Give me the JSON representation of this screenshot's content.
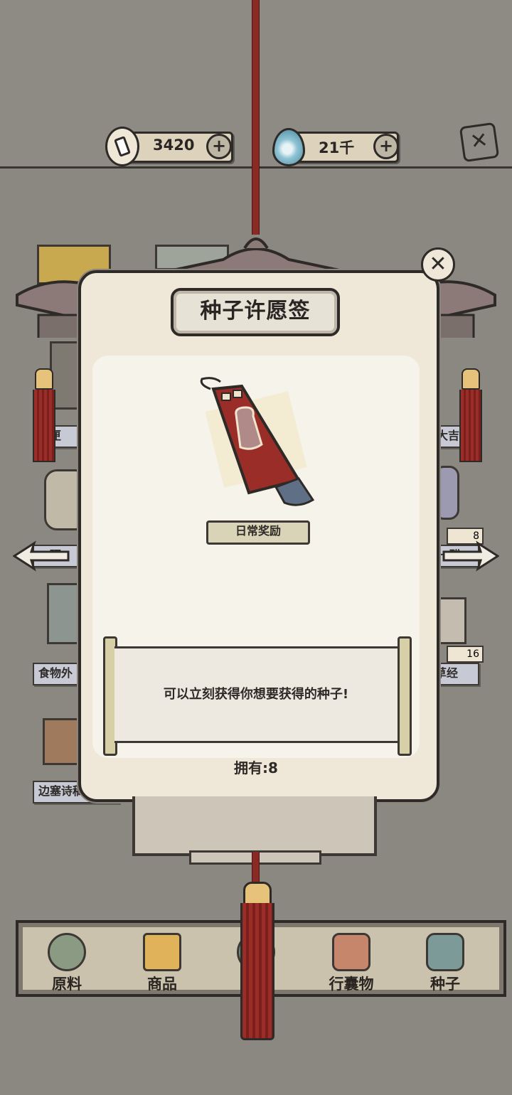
{
  "header": {
    "coins": {
      "value": "3420",
      "add_label": "+"
    },
    "gems": {
      "value": "21千",
      "add_label": "+"
    },
    "close_label": "✕"
  },
  "dialog": {
    "title": "种子许愿签",
    "close_label": "✕",
    "badge": "日常奖励",
    "description": "可以立刻获得你想要获得的种子!",
    "owned": "拥有:8"
  },
  "background": {
    "labels": [
      "一匣",
      "大吉",
      "一研",
      "一醋",
      "食物外",
      "草经",
      "边塞诗稿"
    ],
    "counts": [
      "8",
      "16"
    ]
  },
  "tabs": [
    {
      "label": "原料"
    },
    {
      "label": "商品"
    },
    {
      "label": ""
    },
    {
      "label": "行囊物"
    },
    {
      "label": "种子"
    }
  ],
  "colors": {
    "rope": "#8a2a24",
    "parchment": "#efe8d8",
    "ink": "#2e2a27",
    "background": "#8b8882"
  }
}
